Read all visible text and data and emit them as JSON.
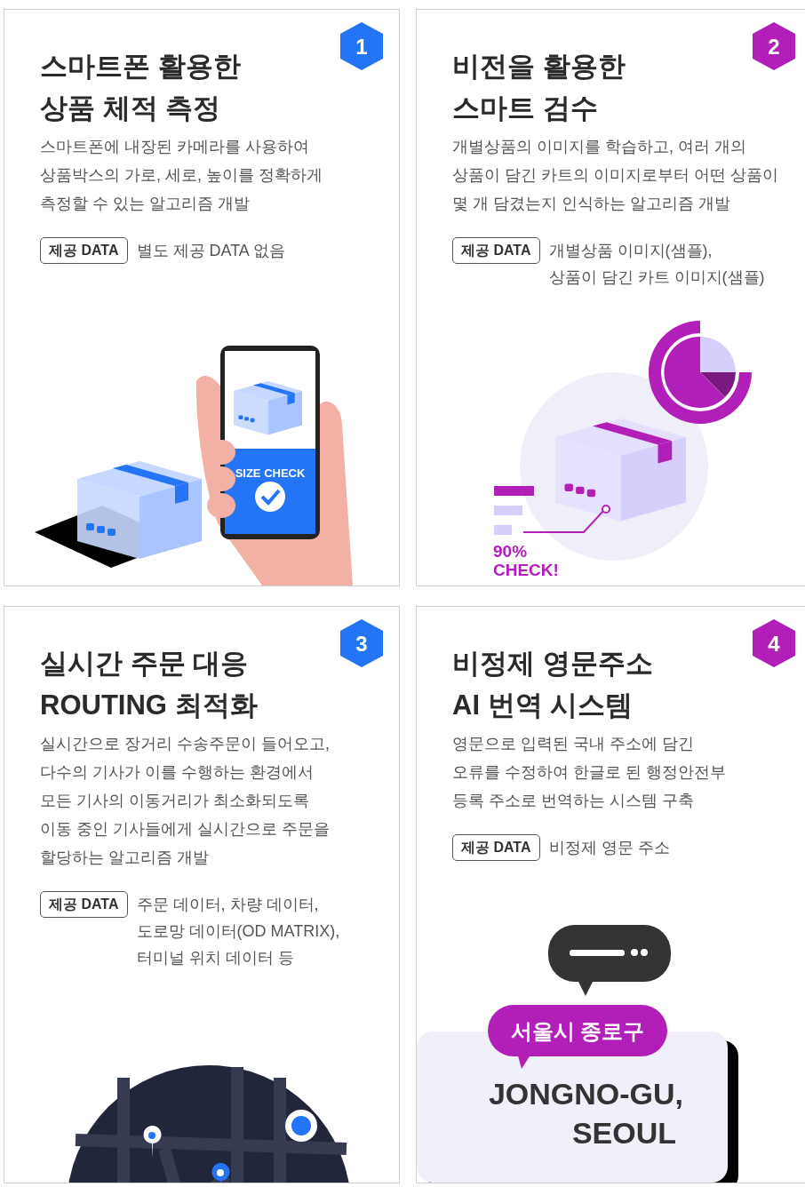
{
  "cards": [
    {
      "number": "1",
      "color": "#2474f6",
      "title": [
        "스마트폰 활용한",
        "상품 체적 측정"
      ],
      "description": [
        "스마트폰에 내장된 카메라를 사용하여",
        "상품박스의 가로, 세로, 높이를 정확하게",
        "측정할 수 있는 알고리즘 개발"
      ],
      "data_label": "제공 DATA",
      "data_value": [
        "별도 제공 DATA 없음"
      ],
      "illustration": {
        "kind": "phone-scan",
        "texts": [
          "SIZE CHECK"
        ]
      }
    },
    {
      "number": "2",
      "color": "#b21fb8",
      "title": [
        "비전을 활용한",
        "스마트 검수"
      ],
      "description": [
        "개별상품의 이미지를 학습하고, 여러 개의",
        "상품이 담긴 카트의 이미지로부터 어떤 상품이",
        "몇 개 담겼는지 인식하는 알고리즘 개발"
      ],
      "data_label": "제공 DATA",
      "data_value": [
        "개별상품 이미지(샘플),",
        "상품이 담긴 카트 이미지(샘플)"
      ],
      "illustration": {
        "kind": "vision-check",
        "texts": [
          "90%",
          "CHECK!"
        ]
      }
    },
    {
      "number": "3",
      "color": "#2474f6",
      "title": [
        "실시간 주문 대응",
        "ROUTING 최적화"
      ],
      "description": [
        "실시간으로 장거리 수송주문이 들어오고,",
        "다수의 기사가 이를 수행하는 환경에서",
        "모든 기사의 이동거리가 최소화되도록",
        "이동 중인 기사들에게 실시간으로 주문을",
        "할당하는 알고리즘 개발"
      ],
      "data_label": "제공 DATA",
      "data_value": [
        "주문 데이터, 차량 데이터,",
        "도로망 데이터(OD MATRIX),",
        "터미널 위치 데이터 등"
      ],
      "illustration": {
        "kind": "route-map"
      }
    },
    {
      "number": "4",
      "color": "#b21fb8",
      "title": [
        "비정제 영문주소",
        "AI 번역 시스템"
      ],
      "description": [
        "영문으로 입력된 국내 주소에 담긴",
        "오류를 수정하여 한글로 된 행정안전부",
        "등록 주소로 번역하는 시스템 구축"
      ],
      "data_label": "제공 DATA",
      "data_value": [
        "비정제 영문 주소"
      ],
      "illustration": {
        "kind": "translation",
        "texts": [
          "서울시 종로구",
          "JONGNO-GU,",
          "SEOUL"
        ]
      }
    }
  ]
}
